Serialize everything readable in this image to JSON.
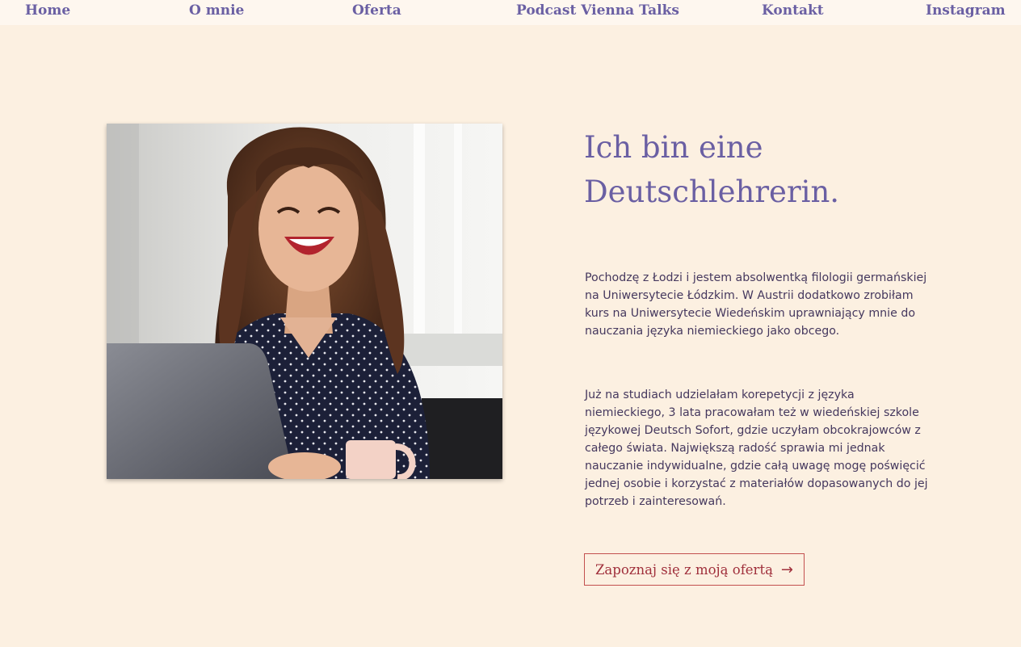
{
  "nav": {
    "home": "Home",
    "about": "O mnie",
    "offer": "Oferta",
    "podcast": "Podcast Vienna Talks",
    "contact": "Kontakt",
    "instagram": "Instagram"
  },
  "hero": {
    "heading_line1": "Ich bin eine",
    "heading_line2": "Deutschlehrerin.",
    "paragraph1": "Pochodzę z Łodzi i jestem absolwentką filologii germańskiej na Uniwersytecie Łódzkim. W Austrii dodatkowo zrobiłam kurs na Uniwersytecie Wiedeńskim uprawniający mnie do nauczania języka niemieckiego jako obcego.",
    "paragraph2": "Już na studiach udzielałam korepetycji z języka niemieckiego,  3 lata pracowałam też w wiedeńskiej szkole językowej Deutsch Sofort, gdzie uczyłam obcokrajowców z całego świata. Największą radość sprawia mi jednak nauczanie indywidualne, gdzie całą uwagę mogę poświęcić jednej osobie i korzystać z materiałów dopasowanych do jej potrzeb i zainteresowań.",
    "cta_label": "Zapoznaj się z moją ofertą",
    "cta_icon": "arrow-right-icon"
  },
  "colors": {
    "background": "#fcf0e1",
    "nav_background": "#fef7ef",
    "accent": "#6a5fa3",
    "body_text": "#45385e",
    "cta": "#a0303c"
  }
}
